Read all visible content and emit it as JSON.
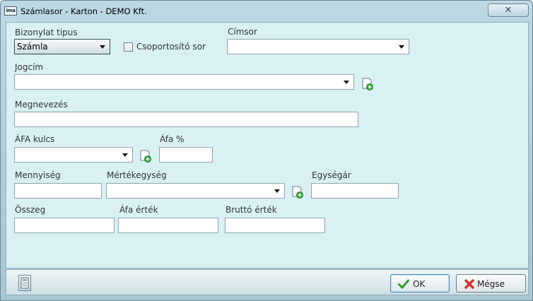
{
  "window": {
    "icon_text": "ima",
    "title": "Számlasor - Karton  - DEMO Kft.",
    "close_label": "✕"
  },
  "form": {
    "bizonylat_tipus": {
      "label": "Bizonylat tipus",
      "value": "Számla"
    },
    "csoportosito": {
      "label": "Csoportosító sor",
      "checked": false
    },
    "cimsor": {
      "label": "Címsor",
      "value": ""
    },
    "jogcim": {
      "label": "Jogcím",
      "value": ""
    },
    "megnevezes": {
      "label": "Megnevezés",
      "value": ""
    },
    "afa_kulcs": {
      "label": "ÁFA kulcs",
      "value": ""
    },
    "afa_szazalek": {
      "label": "Áfa %",
      "value": ""
    },
    "mennyiseg": {
      "label": "Mennyiség",
      "value": ""
    },
    "mertekegyseg": {
      "label": "Mértékegység",
      "value": ""
    },
    "egysegar": {
      "label": "Egységár",
      "value": ""
    },
    "osszeg": {
      "label": "Összeg",
      "value": ""
    },
    "afa_ertek": {
      "label": "Áfa érték",
      "value": ""
    },
    "brutto_ertek": {
      "label": "Bruttó érték",
      "value": ""
    }
  },
  "footer": {
    "ok_label": "OK",
    "cancel_label": "Mégse"
  },
  "colors": {
    "client_bg": "#d9f1f3",
    "frame_bg": "#bcd8e2",
    "ok_icon": "#2e9e2e",
    "cancel_icon": "#d3302a"
  }
}
